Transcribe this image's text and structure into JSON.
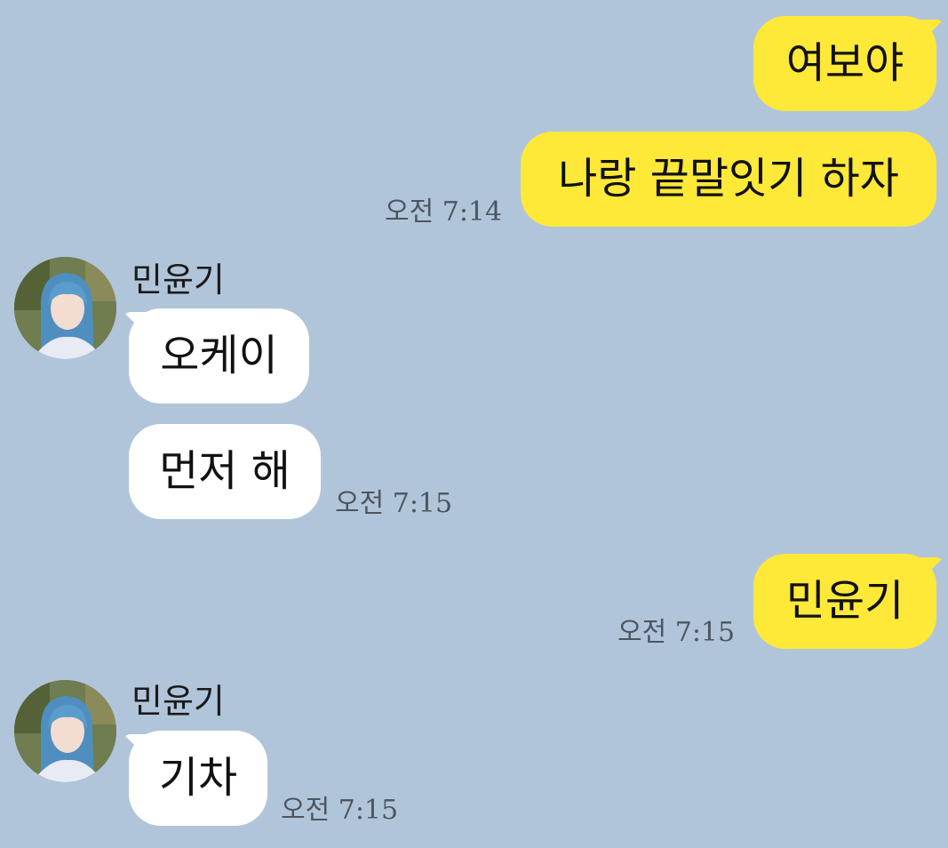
{
  "chat": {
    "messages": [
      {
        "id": "m1",
        "from": "me",
        "text": "여보야"
      },
      {
        "id": "m2",
        "from": "me",
        "text": "나랑 끝말잇기 하자",
        "time": "오전 7:14"
      },
      {
        "id": "m3",
        "from": "them",
        "sender": "민윤기",
        "text": "오케이"
      },
      {
        "id": "m4",
        "from": "them",
        "text": "먼저 해",
        "time": "오전 7:15"
      },
      {
        "id": "m5",
        "from": "me",
        "text": "민윤기",
        "time": "오전 7:15"
      },
      {
        "id": "m6",
        "from": "them",
        "sender": "민윤기",
        "text": "기차",
        "time": "오전 7:15"
      }
    ]
  },
  "colors": {
    "background": "#b1c5da",
    "my_bubble": "#fee838",
    "their_bubble": "#ffffff",
    "timestamp": "#4c5560"
  },
  "icons": {
    "avatar": "profile-photo"
  }
}
